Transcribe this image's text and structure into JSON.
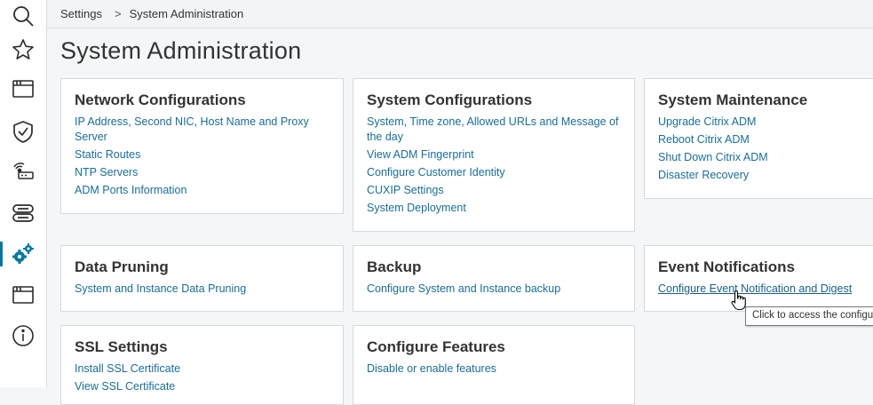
{
  "breadcrumb": {
    "root": "Settings",
    "separator": ">",
    "current": "System Administration"
  },
  "page": {
    "title": "System Administration"
  },
  "sidebar": {
    "items": [
      {
        "icon": "search-icon"
      },
      {
        "icon": "star-icon"
      },
      {
        "icon": "window-icon"
      },
      {
        "icon": "shield-check-icon"
      },
      {
        "icon": "network-icon"
      },
      {
        "icon": "server-icon"
      },
      {
        "icon": "gears-icon",
        "active": true
      },
      {
        "icon": "window-icon"
      },
      {
        "icon": "info-icon"
      }
    ],
    "accent": "#01799c"
  },
  "cards": {
    "network": {
      "title": "Network Configurations",
      "links": [
        "IP Address, Second NIC, Host Name and Proxy Server",
        "Static Routes",
        "NTP Servers",
        "ADM Ports Information"
      ]
    },
    "system_config": {
      "title": "System Configurations",
      "links": [
        "System, Time zone, Allowed URLs and Message of the day",
        "View ADM Fingerprint",
        "Configure Customer Identity",
        "CUXIP Settings",
        "System Deployment"
      ]
    },
    "maintenance": {
      "title": "System Maintenance",
      "links": [
        "Upgrade Citrix ADM",
        "Reboot Citrix ADM",
        "Shut Down Citrix ADM",
        "Disaster Recovery"
      ]
    },
    "pruning": {
      "title": "Data Pruning",
      "links": [
        "System and Instance Data Pruning"
      ]
    },
    "backup": {
      "title": "Backup",
      "links": [
        "Configure System and Instance backup"
      ]
    },
    "events": {
      "title": "Event Notifications",
      "links": [
        "Configure Event Notification and Digest"
      ]
    },
    "ssl": {
      "title": "SSL Settings",
      "links": [
        "Install SSL Certificate",
        "View SSL Certificate"
      ]
    },
    "features": {
      "title": "Configure Features",
      "links": [
        "Disable or enable features"
      ]
    }
  },
  "tooltip": {
    "text": "Click to access the configu"
  },
  "colors": {
    "link": "#1a6d9a",
    "icon": "#2b2b2b",
    "active_icon": "#01799c"
  }
}
